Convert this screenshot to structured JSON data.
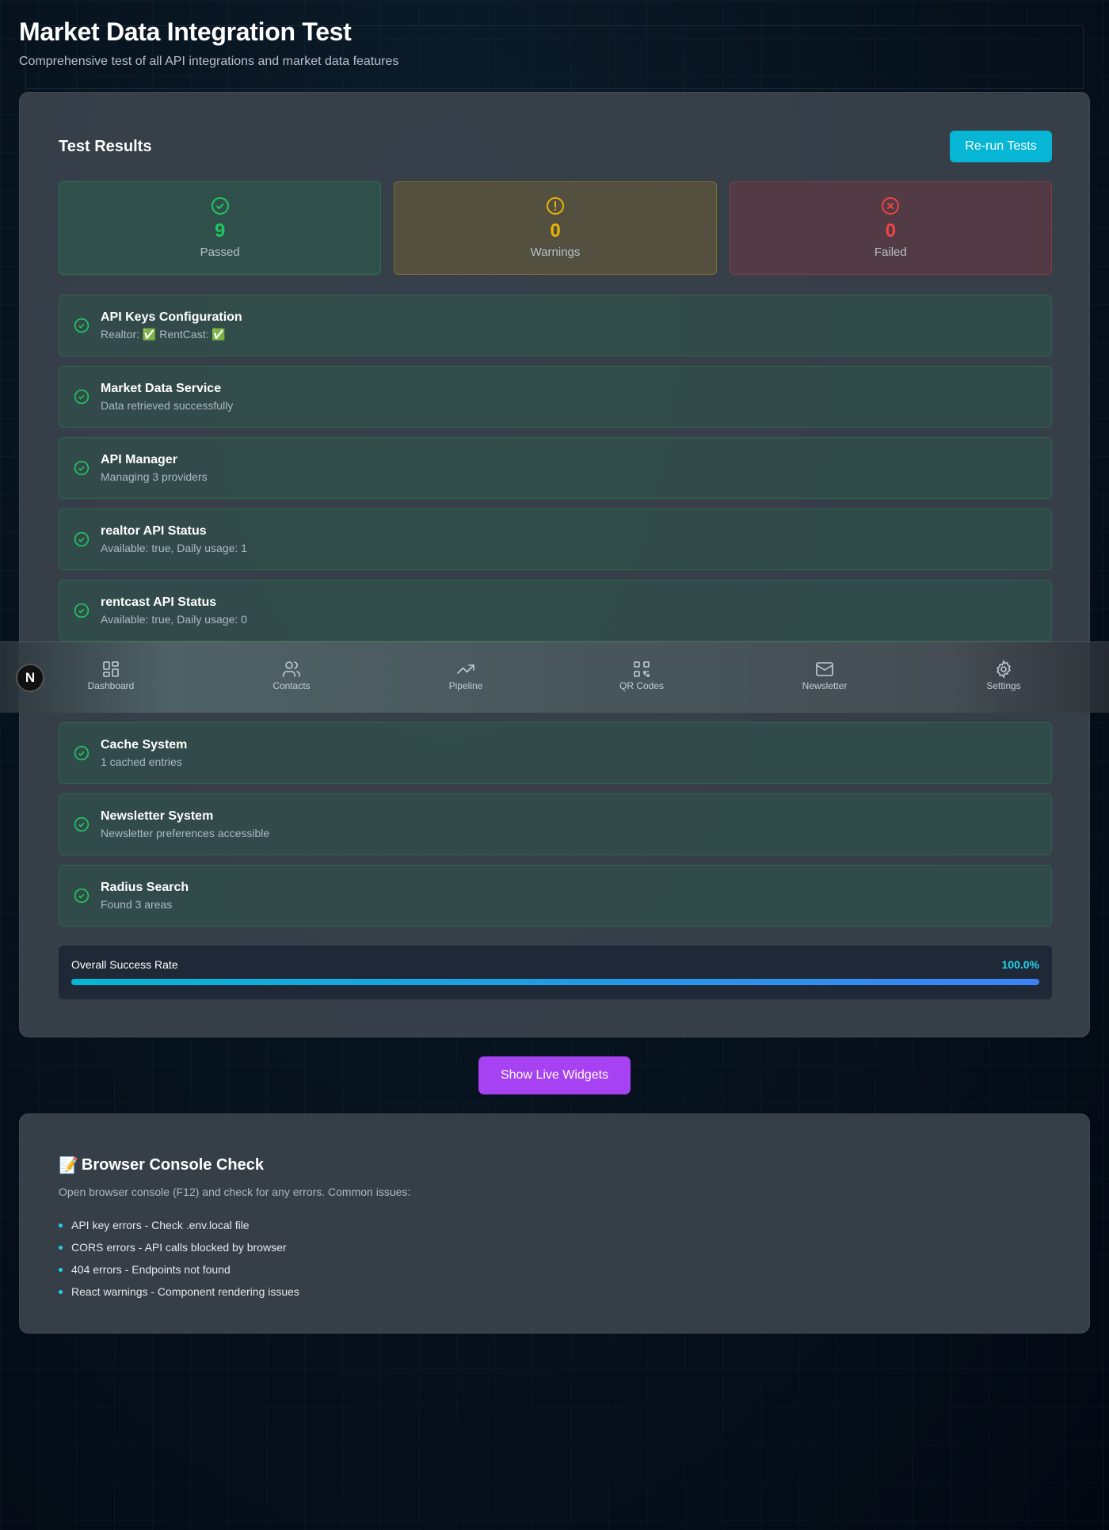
{
  "header": {
    "title": "Market Data Integration Test",
    "subtitle": "Comprehensive test of all API integrations and market data features"
  },
  "results": {
    "title": "Test Results",
    "rerun_label": "Re-run Tests",
    "stats": {
      "passed": {
        "count": "9",
        "label": "Passed",
        "color": "#22c55e"
      },
      "warnings": {
        "count": "0",
        "label": "Warnings",
        "color": "#eab308"
      },
      "failed": {
        "count": "0",
        "label": "Failed",
        "color": "#ef4444"
      }
    },
    "tests": [
      {
        "name": "API Keys Configuration",
        "detail": "Realtor: ✅ RentCast: ✅"
      },
      {
        "name": "Market Data Service",
        "detail": "Data retrieved successfully"
      },
      {
        "name": "API Manager",
        "detail": "Managing 3 providers"
      },
      {
        "name": "realtor API Status",
        "detail": "Available: true, Daily usage: 1"
      },
      {
        "name": "rentcast API Status",
        "detail": "Available: true, Daily usage: 0"
      },
      {
        "name": "Cache System",
        "detail": "1 cached entries"
      },
      {
        "name": "Newsletter System",
        "detail": "Newsletter preferences accessible"
      },
      {
        "name": "Radius Search",
        "detail": "Found 3 areas"
      }
    ],
    "success_rate": {
      "label": "Overall Success Rate",
      "value": "100.0%",
      "fraction": 1.0
    }
  },
  "widgets_button_label": "Show Live Widgets",
  "console": {
    "emoji": "📝",
    "title": "Browser Console Check",
    "description": "Open browser console (F12) and check for any errors. Common issues:",
    "issues": [
      "API key errors - Check .env.local file",
      "CORS errors - API calls blocked by browser",
      "404 errors - Endpoints not found",
      "React warnings - Component rendering issues"
    ]
  },
  "nav": {
    "logo": "N",
    "items": [
      {
        "label": "Dashboard",
        "icon": "dashboard-icon"
      },
      {
        "label": "Contacts",
        "icon": "contacts-icon"
      },
      {
        "label": "Pipeline",
        "icon": "trending-up-icon"
      },
      {
        "label": "QR Codes",
        "icon": "qr-code-icon"
      },
      {
        "label": "Newsletter",
        "icon": "mail-icon"
      },
      {
        "label": "Settings",
        "icon": "gear-icon"
      }
    ]
  },
  "colors": {
    "accent": "#06b6d4",
    "purple": "#a742f3",
    "success": "#22c55e"
  }
}
